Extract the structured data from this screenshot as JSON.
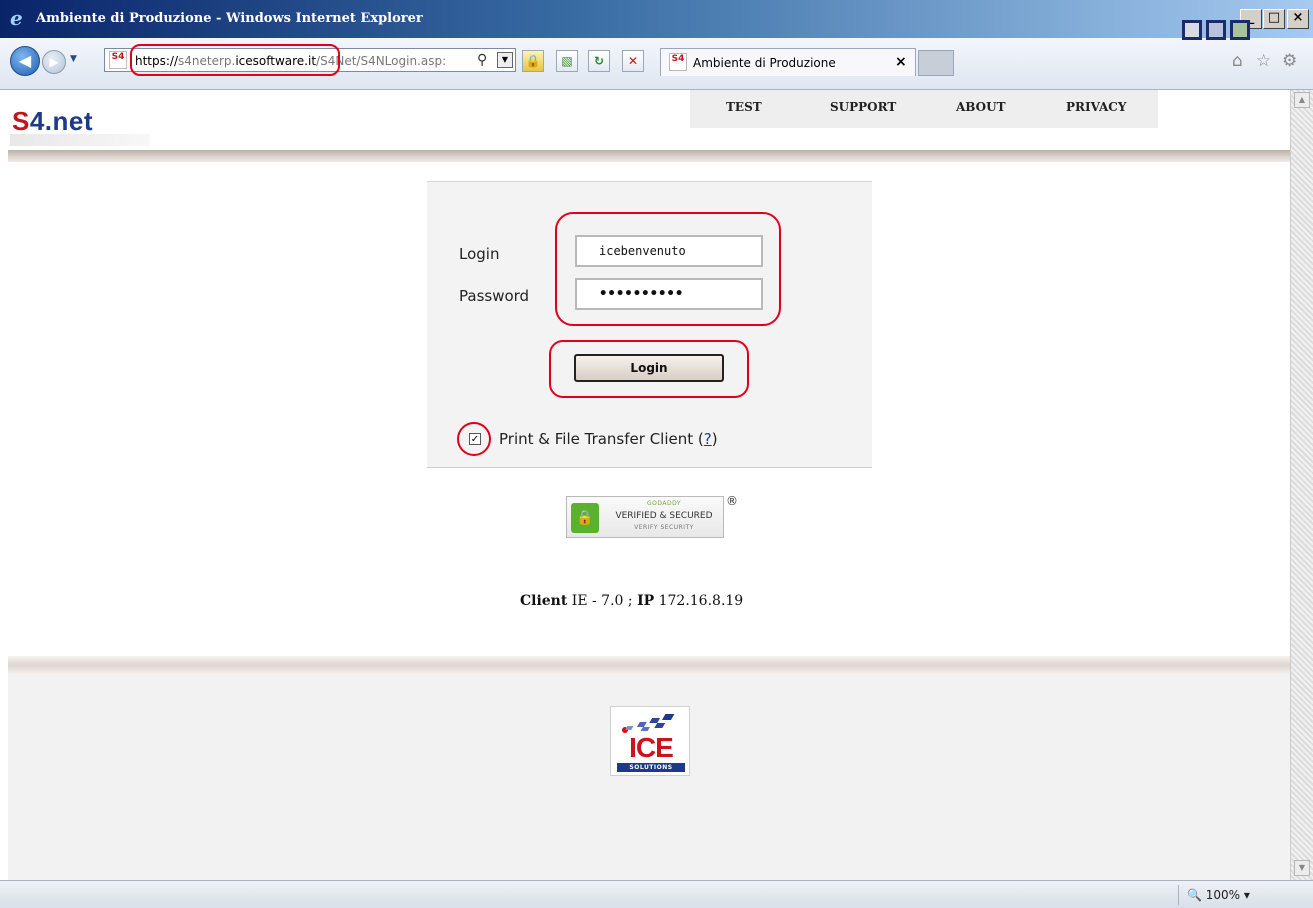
{
  "window": {
    "title": "Ambiente di Produzione - Windows Internet Explorer",
    "min_label": "_",
    "max_label": "□",
    "close_label": "×"
  },
  "browser": {
    "back_glyph": "◀",
    "forward_glyph": "▶",
    "history_glyph": "▼",
    "site_icon_text": "S4",
    "url_parts": [
      "https://",
      "s4neterp.",
      "icesoftware.it",
      "/S4Net/S4NLogin.asp:"
    ],
    "search_glyph": "⚲",
    "dropdown_glyph": "▼",
    "lock_glyph": "🔒",
    "compat_glyph": "▧",
    "refresh_glyph": "↻",
    "stop_glyph": "✕",
    "tab_label": "Ambiente di Produzione",
    "tab_close": "×",
    "home_glyph": "⌂",
    "favorites_glyph": "☆",
    "tools_glyph": "⚙"
  },
  "header": {
    "logo_s": "S",
    "logo_rest": "4.net",
    "menu": [
      "TEST",
      "SUPPORT",
      "ABOUT",
      "PRIVACY"
    ],
    "theme_colors": [
      "#d6dbe5",
      "#b8c2da",
      "#a9c39a"
    ]
  },
  "login": {
    "login_label": "Login",
    "password_label": "Password",
    "login_value": "icebenvenuto",
    "password_value": "••••••••••",
    "button_label": "Login",
    "checkbox_checked": true,
    "checkbox_mark": "✓",
    "checkbox_label": "Print & File Transfer Client",
    "help_open": "(",
    "help_link": "?",
    "help_close": ")"
  },
  "seal": {
    "line1": "GODADDY",
    "line2": "VERIFIED & SECURED",
    "line3": "VERIFY SECURITY",
    "registered": "®",
    "lock_glyph": "🔒"
  },
  "client": {
    "client_label": "Client",
    "client_value": "IE - 7.0 ;",
    "ip_label": "IP",
    "ip_value": "172.16.8.19"
  },
  "footer": {
    "logo_text": "ICE",
    "logo_sub": "SOLUTIONS"
  },
  "status": {
    "zoom_icon": "🔍",
    "zoom": "100%",
    "zoom_drop": "▾"
  },
  "colors": {
    "highlight_ring": "#e0001b",
    "brand_red": "#c4141b",
    "brand_blue": "#1d3a8a"
  }
}
